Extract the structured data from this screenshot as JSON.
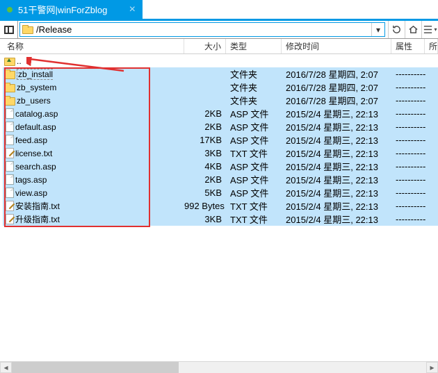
{
  "tab": {
    "title": "51干警网|winForZblog",
    "status": "active"
  },
  "path": "/Release",
  "columns": {
    "name": "名称",
    "size": "大小",
    "type": "类型",
    "modified": "修改时间",
    "attr": "属性",
    "extra": "所"
  },
  "parent_entry": {
    "name": ".."
  },
  "files": [
    {
      "name": "zb_install",
      "size": "",
      "type": "文件夹",
      "modified": "2016/7/28 星期四, 2:07",
      "attr": "----------",
      "icon": "folder",
      "first": true
    },
    {
      "name": "zb_system",
      "size": "",
      "type": "文件夹",
      "modified": "2016/7/28 星期四, 2:07",
      "attr": "----------",
      "icon": "folder"
    },
    {
      "name": "zb_users",
      "size": "",
      "type": "文件夹",
      "modified": "2016/7/28 星期四, 2:07",
      "attr": "----------",
      "icon": "folder"
    },
    {
      "name": "catalog.asp",
      "size": "2KB",
      "type": "ASP 文件",
      "modified": "2015/2/4 星期三, 22:13",
      "attr": "----------",
      "icon": "file"
    },
    {
      "name": "default.asp",
      "size": "2KB",
      "type": "ASP 文件",
      "modified": "2015/2/4 星期三, 22:13",
      "attr": "----------",
      "icon": "file"
    },
    {
      "name": "feed.asp",
      "size": "17KB",
      "type": "ASP 文件",
      "modified": "2015/2/4 星期三, 22:13",
      "attr": "----------",
      "icon": "file"
    },
    {
      "name": "license.txt",
      "size": "3KB",
      "type": "TXT 文件",
      "modified": "2015/2/4 星期三, 22:13",
      "attr": "----------",
      "icon": "txt"
    },
    {
      "name": "search.asp",
      "size": "4KB",
      "type": "ASP 文件",
      "modified": "2015/2/4 星期三, 22:13",
      "attr": "----------",
      "icon": "file"
    },
    {
      "name": "tags.asp",
      "size": "2KB",
      "type": "ASP 文件",
      "modified": "2015/2/4 星期三, 22:13",
      "attr": "----------",
      "icon": "file"
    },
    {
      "name": "view.asp",
      "size": "5KB",
      "type": "ASP 文件",
      "modified": "2015/2/4 星期三, 22:13",
      "attr": "----------",
      "icon": "file"
    },
    {
      "name": "安装指南.txt",
      "size": "992 Bytes",
      "type": "TXT 文件",
      "modified": "2015/2/4 星期三, 22:13",
      "attr": "----------",
      "icon": "txt"
    },
    {
      "name": "升级指南.txt",
      "size": "3KB",
      "type": "TXT 文件",
      "modified": "2015/2/4 星期三, 22:13",
      "attr": "----------",
      "icon": "txt"
    }
  ]
}
